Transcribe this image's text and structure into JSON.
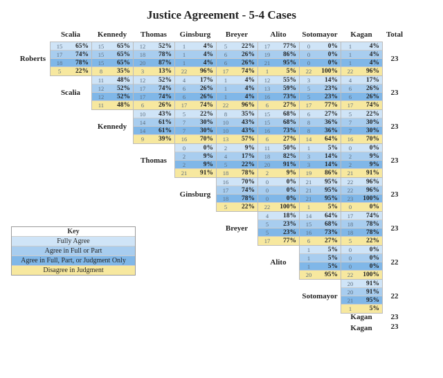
{
  "title": "Justice Agreement - 5-4 Cases",
  "columns": [
    "Scalia",
    "Kennedy",
    "Thomas",
    "Ginsburg",
    "Breyer",
    "Alito",
    "Sotomayor",
    "Kagan"
  ],
  "total_label": "Total",
  "rows": [
    {
      "name": "Roberts",
      "total": 23
    },
    {
      "name": "Scalia",
      "total": 23
    },
    {
      "name": "Kennedy",
      "total": 23
    },
    {
      "name": "Thomas",
      "total": 23
    },
    {
      "name": "Ginsburg",
      "total": 23
    },
    {
      "name": "Breyer",
      "total": 23
    },
    {
      "name": "Alito",
      "total": 22
    },
    {
      "name": "Sotomayor",
      "total": 22
    },
    {
      "name": "Kagan",
      "total": 23
    }
  ],
  "key": {
    "title": "Key",
    "items": [
      "Fully Agree",
      "Agree in Full or Part",
      "Agree in Full, Part, or Judgment Only",
      "Disagree in Judgment"
    ]
  },
  "chart_data": {
    "type": "table",
    "description": "Justice pairwise agreement in 5-4 cases. Upper-triangular matrix. For each ordered (row, column) pair: four rows = [Fully Agree, Agree in Full or Part, Agree in Full/Part/Judgment Only, Disagree in Judgment]; each cell shows count and percent.",
    "matrix": {
      "Roberts": {
        "Scalia": [
          {
            "c": 15,
            "p": "65%"
          },
          {
            "c": 17,
            "p": "74%"
          },
          {
            "c": 18,
            "p": "78%"
          },
          {
            "c": 5,
            "p": "22%"
          }
        ],
        "Kennedy": [
          {
            "c": 15,
            "p": "65%"
          },
          {
            "c": 15,
            "p": "65%"
          },
          {
            "c": 15,
            "p": "65%"
          },
          {
            "c": 8,
            "p": "35%"
          }
        ],
        "Thomas": [
          {
            "c": 12,
            "p": "52%"
          },
          {
            "c": 18,
            "p": "78%"
          },
          {
            "c": 20,
            "p": "87%"
          },
          {
            "c": 3,
            "p": "13%"
          }
        ],
        "Ginsburg": [
          {
            "c": 1,
            "p": "4%"
          },
          {
            "c": 1,
            "p": "4%"
          },
          {
            "c": 1,
            "p": "4%"
          },
          {
            "c": 22,
            "p": "96%"
          }
        ],
        "Breyer": [
          {
            "c": 5,
            "p": "22%"
          },
          {
            "c": 6,
            "p": "26%"
          },
          {
            "c": 6,
            "p": "26%"
          },
          {
            "c": 17,
            "p": "74%"
          }
        ],
        "Alito": [
          {
            "c": 17,
            "p": "77%"
          },
          {
            "c": 19,
            "p": "86%"
          },
          {
            "c": 21,
            "p": "95%"
          },
          {
            "c": 1,
            "p": "5%"
          }
        ],
        "Sotomayor": [
          {
            "c": 0,
            "p": "0%"
          },
          {
            "c": 0,
            "p": "0%"
          },
          {
            "c": 0,
            "p": "0%"
          },
          {
            "c": 22,
            "p": "100%"
          }
        ],
        "Kagan": [
          {
            "c": 1,
            "p": "4%"
          },
          {
            "c": 1,
            "p": "4%"
          },
          {
            "c": 1,
            "p": "4%"
          },
          {
            "c": 22,
            "p": "96%"
          }
        ]
      },
      "Scalia": {
        "Kennedy": [
          {
            "c": 11,
            "p": "48%"
          },
          {
            "c": 12,
            "p": "52%"
          },
          {
            "c": 12,
            "p": "52%"
          },
          {
            "c": 11,
            "p": "48%"
          }
        ],
        "Thomas": [
          {
            "c": 12,
            "p": "52%"
          },
          {
            "c": 17,
            "p": "74%"
          },
          {
            "c": 17,
            "p": "74%"
          },
          {
            "c": 6,
            "p": "26%"
          }
        ],
        "Ginsburg": [
          {
            "c": 4,
            "p": "17%"
          },
          {
            "c": 6,
            "p": "26%"
          },
          {
            "c": 6,
            "p": "26%"
          },
          {
            "c": 17,
            "p": "74%"
          }
        ],
        "Breyer": [
          {
            "c": 1,
            "p": "4%"
          },
          {
            "c": 1,
            "p": "4%"
          },
          {
            "c": 1,
            "p": "4%"
          },
          {
            "c": 22,
            "p": "96%"
          }
        ],
        "Alito": [
          {
            "c": 12,
            "p": "55%"
          },
          {
            "c": 13,
            "p": "59%"
          },
          {
            "c": 16,
            "p": "73%"
          },
          {
            "c": 6,
            "p": "27%"
          }
        ],
        "Sotomayor": [
          {
            "c": 3,
            "p": "14%"
          },
          {
            "c": 5,
            "p": "23%"
          },
          {
            "c": 5,
            "p": "23%"
          },
          {
            "c": 17,
            "p": "77%"
          }
        ],
        "Kagan": [
          {
            "c": 4,
            "p": "17%"
          },
          {
            "c": 6,
            "p": "26%"
          },
          {
            "c": 6,
            "p": "26%"
          },
          {
            "c": 17,
            "p": "74%"
          }
        ]
      },
      "Kennedy": {
        "Thomas": [
          {
            "c": 10,
            "p": "43%"
          },
          {
            "c": 14,
            "p": "61%"
          },
          {
            "c": 14,
            "p": "61%"
          },
          {
            "c": 9,
            "p": "39%"
          }
        ],
        "Ginsburg": [
          {
            "c": 5,
            "p": "22%"
          },
          {
            "c": 7,
            "p": "30%"
          },
          {
            "c": 7,
            "p": "30%"
          },
          {
            "c": 16,
            "p": "70%"
          }
        ],
        "Breyer": [
          {
            "c": 8,
            "p": "35%"
          },
          {
            "c": 10,
            "p": "43%"
          },
          {
            "c": 10,
            "p": "43%"
          },
          {
            "c": 13,
            "p": "57%"
          }
        ],
        "Alito": [
          {
            "c": 15,
            "p": "68%"
          },
          {
            "c": 15,
            "p": "68%"
          },
          {
            "c": 16,
            "p": "73%"
          },
          {
            "c": 6,
            "p": "27%"
          }
        ],
        "Sotomayor": [
          {
            "c": 6,
            "p": "27%"
          },
          {
            "c": 8,
            "p": "36%"
          },
          {
            "c": 8,
            "p": "36%"
          },
          {
            "c": 14,
            "p": "64%"
          }
        ],
        "Kagan": [
          {
            "c": 5,
            "p": "22%"
          },
          {
            "c": 7,
            "p": "30%"
          },
          {
            "c": 7,
            "p": "30%"
          },
          {
            "c": 16,
            "p": "70%"
          }
        ]
      },
      "Thomas": {
        "Ginsburg": [
          {
            "c": 0,
            "p": "0%"
          },
          {
            "c": 2,
            "p": "9%"
          },
          {
            "c": 2,
            "p": "9%"
          },
          {
            "c": 21,
            "p": "91%"
          }
        ],
        "Breyer": [
          {
            "c": 2,
            "p": "9%"
          },
          {
            "c": 4,
            "p": "17%"
          },
          {
            "c": 5,
            "p": "22%"
          },
          {
            "c": 18,
            "p": "78%"
          }
        ],
        "Alito": [
          {
            "c": 11,
            "p": "50%"
          },
          {
            "c": 18,
            "p": "82%"
          },
          {
            "c": 20,
            "p": "91%"
          },
          {
            "c": 2,
            "p": "9%"
          }
        ],
        "Sotomayor": [
          {
            "c": 1,
            "p": "5%"
          },
          {
            "c": 3,
            "p": "14%"
          },
          {
            "c": 3,
            "p": "14%"
          },
          {
            "c": 19,
            "p": "86%"
          }
        ],
        "Kagan": [
          {
            "c": 0,
            "p": "0%"
          },
          {
            "c": 2,
            "p": "9%"
          },
          {
            "c": 2,
            "p": "9%"
          },
          {
            "c": 21,
            "p": "91%"
          }
        ]
      },
      "Ginsburg": {
        "Breyer": [
          {
            "c": 16,
            "p": "70%"
          },
          {
            "c": 17,
            "p": "74%"
          },
          {
            "c": 18,
            "p": "78%"
          },
          {
            "c": 5,
            "p": "22%"
          }
        ],
        "Alito": [
          {
            "c": 0,
            "p": "0%"
          },
          {
            "c": 0,
            "p": "0%"
          },
          {
            "c": 0,
            "p": "0%"
          },
          {
            "c": 22,
            "p": "100%"
          }
        ],
        "Sotomayor": [
          {
            "c": 21,
            "p": "95%"
          },
          {
            "c": 21,
            "p": "95%"
          },
          {
            "c": 21,
            "p": "95%"
          },
          {
            "c": 1,
            "p": "5%"
          }
        ],
        "Kagan": [
          {
            "c": 22,
            "p": "96%"
          },
          {
            "c": 22,
            "p": "96%"
          },
          {
            "c": 23,
            "p": "100%"
          },
          {
            "c": 0,
            "p": "0%"
          }
        ]
      },
      "Breyer": {
        "Alito": [
          {
            "c": 4,
            "p": "18%"
          },
          {
            "c": 5,
            "p": "23%"
          },
          {
            "c": 5,
            "p": "23%"
          },
          {
            "c": 17,
            "p": "77%"
          }
        ],
        "Sotomayor": [
          {
            "c": 14,
            "p": "64%"
          },
          {
            "c": 15,
            "p": "68%"
          },
          {
            "c": 16,
            "p": "73%"
          },
          {
            "c": 6,
            "p": "27%"
          }
        ],
        "Kagan": [
          {
            "c": 17,
            "p": "74%"
          },
          {
            "c": 18,
            "p": "78%"
          },
          {
            "c": 18,
            "p": "78%"
          },
          {
            "c": 5,
            "p": "22%"
          }
        ]
      },
      "Alito": {
        "Sotomayor": [
          {
            "c": 1,
            "p": "5%"
          },
          {
            "c": 1,
            "p": "5%"
          },
          {
            "c": 1,
            "p": "5%"
          },
          {
            "c": 20,
            "p": "95%"
          }
        ],
        "Kagan": [
          {
            "c": 0,
            "p": "0%"
          },
          {
            "c": 0,
            "p": "0%"
          },
          {
            "c": 0,
            "p": "0%"
          },
          {
            "c": 22,
            "p": "100%"
          }
        ]
      },
      "Sotomayor": {
        "Kagan": [
          {
            "c": 20,
            "p": "91%"
          },
          {
            "c": 20,
            "p": "91%"
          },
          {
            "c": 21,
            "p": "95%"
          },
          {
            "c": 1,
            "p": "5%"
          }
        ]
      }
    }
  }
}
